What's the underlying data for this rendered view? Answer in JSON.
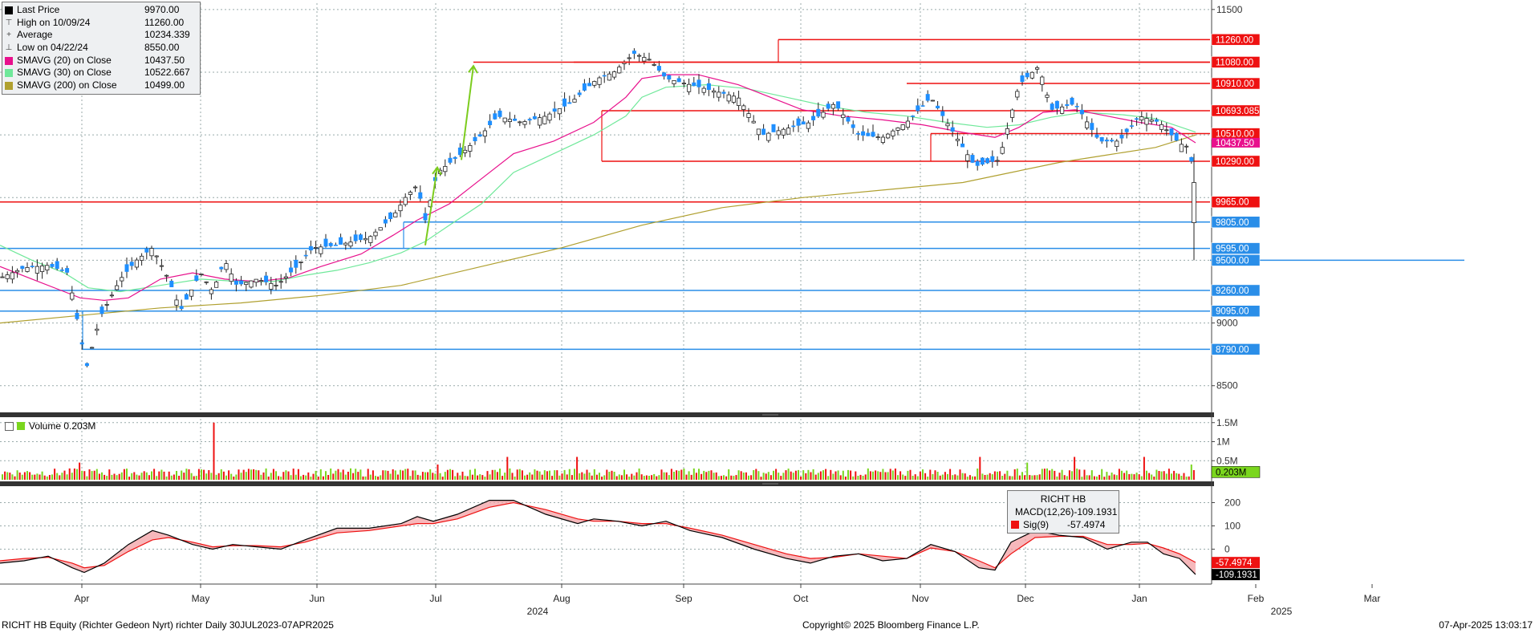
{
  "legend": {
    "last_price_label": "Last Price",
    "last_price": "9970.00",
    "high_label": "High on 10/09/24",
    "high": "11260.00",
    "average_label": "Average",
    "average": "10234.339",
    "low_label": "Low on 04/22/24",
    "low": "8550.00",
    "sma20_label": "SMAVG (20)  on Close",
    "sma20": "10437.50",
    "sma30_label": "SMAVG (30)  on Close",
    "sma30": "10522.667",
    "sma200_label": "SMAVG (200)  on Close",
    "sma200": "10499.00"
  },
  "volume_legend": {
    "label": "Volume",
    "value": "0.203M"
  },
  "macd_legend": {
    "title": "RICHT HB",
    "macd_label": "MACD(12,26)",
    "macd_value": "-109.1931",
    "sig_label": "Sig(9)",
    "sig_value": "-57.4974"
  },
  "footer": {
    "left": "RICHT HB Equity (Richter Gedeon Nyrt) richter  Daily 30JUL2023-07APR2025",
    "center": "Copyright© 2025 Bloomberg Finance L.P.",
    "right": "07-Apr-2025 13:03:17"
  },
  "colors": {
    "up": "#1f8fff",
    "down": "#1f8fff",
    "sma20": "#e8108c",
    "sma30": "#6fe89a",
    "sma200": "#b0a030",
    "vol_up": "#7ad61e",
    "vol_down": "#ee1111",
    "resistance": "#ee1111",
    "support": "#2a8ee8",
    "arrow": "#7ccc1e",
    "macd": "#000000",
    "signal": "#ee1111"
  },
  "chart_data": {
    "type": "candlestick",
    "price_axis": {
      "ticks": [
        8500,
        9000,
        11500
      ],
      "range": [
        8300,
        11550
      ]
    },
    "time_axis": {
      "months": [
        "Apr",
        "May",
        "Jun",
        "Jul",
        "Aug",
        "Sep",
        "Oct",
        "Nov",
        "Dec",
        "Jan",
        "Feb",
        "Mar"
      ],
      "years": [
        "2024",
        "2025"
      ]
    },
    "horizontal_levels": [
      {
        "value": 11260.0,
        "label": "11260.00",
        "kind": "resistance"
      },
      {
        "value": 11080.0,
        "label": "11080.00",
        "kind": "resistance"
      },
      {
        "value": 10910.0,
        "label": "10910.00",
        "kind": "resistance"
      },
      {
        "value": 10693.085,
        "label": "10693.085",
        "kind": "resistance"
      },
      {
        "value": 10510.0,
        "label": "10510.00",
        "kind": "resistance"
      },
      {
        "value": 10290.0,
        "label": "10290.00",
        "kind": "resistance"
      },
      {
        "value": 9965.0,
        "label": "9965.00",
        "kind": "resistance"
      },
      {
        "value": 9805.0,
        "label": "9805.00",
        "kind": "support"
      },
      {
        "value": 9595.0,
        "label": "9595.00",
        "kind": "support"
      },
      {
        "value": 9500.0,
        "label": "9500.00",
        "kind": "support"
      },
      {
        "value": 9260.0,
        "label": "9260.00",
        "kind": "support"
      },
      {
        "value": 9095.0,
        "label": "9095.00",
        "kind": "support"
      },
      {
        "value": 8790.0,
        "label": "8790.00",
        "kind": "support"
      }
    ],
    "axis_badges": [
      {
        "value": 10437.5,
        "label": "10437.50"
      },
      {
        "value": 10390,
        "label": "10290.00"
      }
    ],
    "close_path": [
      [
        0,
        9360
      ],
      [
        30,
        9440
      ],
      [
        60,
        9460
      ],
      [
        85,
        9400
      ],
      [
        100,
        8900
      ],
      [
        108,
        8650
      ],
      [
        125,
        9050
      ],
      [
        150,
        9350
      ],
      [
        170,
        9500
      ],
      [
        190,
        9600
      ],
      [
        210,
        9350
      ],
      [
        225,
        9100
      ],
      [
        250,
        9400
      ],
      [
        265,
        9250
      ],
      [
        280,
        9500
      ],
      [
        295,
        9300
      ],
      [
        320,
        9350
      ],
      [
        345,
        9300
      ],
      [
        370,
        9450
      ],
      [
        390,
        9600
      ],
      [
        420,
        9620
      ],
      [
        460,
        9680
      ],
      [
        490,
        9850
      ],
      [
        505,
        10000
      ],
      [
        520,
        10100
      ],
      [
        530,
        9820
      ],
      [
        545,
        10200
      ],
      [
        575,
        10350
      ],
      [
        600,
        10500
      ],
      [
        620,
        10650
      ],
      [
        650,
        10600
      ],
      [
        680,
        10650
      ],
      [
        710,
        10750
      ],
      [
        745,
        10950
      ],
      [
        765,
        11000
      ],
      [
        790,
        11150
      ],
      [
        810,
        11100
      ],
      [
        830,
        10950
      ],
      [
        860,
        10900
      ],
      [
        890,
        10850
      ],
      [
        920,
        10800
      ],
      [
        950,
        10500
      ],
      [
        980,
        10550
      ],
      [
        1010,
        10600
      ],
      [
        1040,
        10750
      ],
      [
        1070,
        10500
      ],
      [
        1100,
        10480
      ],
      [
        1130,
        10600
      ],
      [
        1160,
        10800
      ],
      [
        1190,
        10500
      ],
      [
        1215,
        10250
      ],
      [
        1245,
        10300
      ],
      [
        1270,
        10900
      ],
      [
        1295,
        11050
      ],
      [
        1310,
        10700
      ],
      [
        1340,
        10750
      ],
      [
        1370,
        10450
      ],
      [
        1395,
        10450
      ],
      [
        1420,
        10650
      ],
      [
        1445,
        10600
      ],
      [
        1470,
        10430
      ],
      [
        1483,
        10400
      ],
      [
        1490,
        9970
      ],
      [
        1495,
        9970
      ]
    ],
    "sma20": [
      [
        0,
        9450
      ],
      [
        40,
        9350
      ],
      [
        80,
        9250
      ],
      [
        100,
        9200
      ],
      [
        130,
        9180
      ],
      [
        160,
        9200
      ],
      [
        200,
        9350
      ],
      [
        240,
        9400
      ],
      [
        280,
        9350
      ],
      [
        320,
        9330
      ],
      [
        360,
        9360
      ],
      [
        400,
        9450
      ],
      [
        450,
        9550
      ],
      [
        490,
        9700
      ],
      [
        520,
        9820
      ],
      [
        560,
        9950
      ],
      [
        600,
        10150
      ],
      [
        640,
        10350
      ],
      [
        690,
        10450
      ],
      [
        740,
        10600
      ],
      [
        780,
        10800
      ],
      [
        800,
        10950
      ],
      [
        830,
        10980
      ],
      [
        870,
        10980
      ],
      [
        920,
        10900
      ],
      [
        960,
        10800
      ],
      [
        1000,
        10700
      ],
      [
        1050,
        10650
      ],
      [
        1100,
        10620
      ],
      [
        1150,
        10580
      ],
      [
        1200,
        10520
      ],
      [
        1240,
        10480
      ],
      [
        1270,
        10560
      ],
      [
        1300,
        10680
      ],
      [
        1340,
        10700
      ],
      [
        1380,
        10650
      ],
      [
        1420,
        10600
      ],
      [
        1460,
        10560
      ],
      [
        1490,
        10437
      ]
    ],
    "sma30": [
      [
        0,
        9620
      ],
      [
        40,
        9500
      ],
      [
        80,
        9400
      ],
      [
        110,
        9280
      ],
      [
        150,
        9250
      ],
      [
        200,
        9300
      ],
      [
        250,
        9350
      ],
      [
        300,
        9330
      ],
      [
        340,
        9330
      ],
      [
        380,
        9380
      ],
      [
        420,
        9420
      ],
      [
        460,
        9480
      ],
      [
        500,
        9560
      ],
      [
        530,
        9650
      ],
      [
        560,
        9780
      ],
      [
        600,
        9950
      ],
      [
        640,
        10200
      ],
      [
        690,
        10350
      ],
      [
        740,
        10500
      ],
      [
        780,
        10650
      ],
      [
        800,
        10800
      ],
      [
        830,
        10880
      ],
      [
        880,
        10900
      ],
      [
        930,
        10870
      ],
      [
        980,
        10800
      ],
      [
        1030,
        10730
      ],
      [
        1080,
        10680
      ],
      [
        1130,
        10650
      ],
      [
        1180,
        10600
      ],
      [
        1230,
        10560
      ],
      [
        1270,
        10580
      ],
      [
        1310,
        10640
      ],
      [
        1350,
        10680
      ],
      [
        1400,
        10660
      ],
      [
        1440,
        10630
      ],
      [
        1490,
        10522
      ]
    ],
    "sma200": [
      [
        0,
        9000
      ],
      [
        100,
        9060
      ],
      [
        200,
        9120
      ],
      [
        300,
        9160
      ],
      [
        400,
        9220
      ],
      [
        500,
        9300
      ],
      [
        600,
        9450
      ],
      [
        700,
        9600
      ],
      [
        800,
        9780
      ],
      [
        900,
        9920
      ],
      [
        1000,
        10000
      ],
      [
        1100,
        10060
      ],
      [
        1200,
        10120
      ],
      [
        1260,
        10200
      ],
      [
        1320,
        10280
      ],
      [
        1380,
        10340
      ],
      [
        1440,
        10400
      ],
      [
        1490,
        10499
      ]
    ],
    "volume": {
      "axis_ticks": [
        "1.5M",
        "1M",
        "0.5M"
      ],
      "last": "0.203M",
      "spikes": [
        [
          266,
          1.5
        ],
        [
          632,
          0.6
        ],
        [
          720,
          0.6
        ],
        [
          1220,
          0.6
        ],
        [
          1340,
          0.6
        ],
        [
          1427,
          0.6
        ],
        [
          1485,
          0.4
        ],
        [
          100,
          0.45
        ],
        [
          545,
          0.4
        ],
        [
          1280,
          0.45
        ]
      ]
    },
    "macd": {
      "axis_ticks": [
        200,
        100,
        0
      ],
      "range": [
        -150,
        250
      ],
      "macd_last": -109.1931,
      "signal_last": -57.4974,
      "macd": [
        [
          0,
          -60
        ],
        [
          30,
          -50
        ],
        [
          60,
          -30
        ],
        [
          90,
          -80
        ],
        [
          105,
          -100
        ],
        [
          130,
          -60
        ],
        [
          160,
          20
        ],
        [
          190,
          80
        ],
        [
          210,
          60
        ],
        [
          240,
          20
        ],
        [
          265,
          0
        ],
        [
          290,
          20
        ],
        [
          320,
          10
        ],
        [
          350,
          0
        ],
        [
          380,
          40
        ],
        [
          420,
          90
        ],
        [
          460,
          90
        ],
        [
          500,
          110
        ],
        [
          520,
          140
        ],
        [
          540,
          120
        ],
        [
          570,
          150
        ],
        [
          610,
          210
        ],
        [
          640,
          210
        ],
        [
          680,
          150
        ],
        [
          720,
          110
        ],
        [
          740,
          130
        ],
        [
          770,
          120
        ],
        [
          800,
          100
        ],
        [
          830,
          120
        ],
        [
          860,
          80
        ],
        [
          900,
          50
        ],
        [
          940,
          0
        ],
        [
          980,
          -40
        ],
        [
          1010,
          -60
        ],
        [
          1040,
          -30
        ],
        [
          1070,
          -20
        ],
        [
          1100,
          -50
        ],
        [
          1130,
          -40
        ],
        [
          1160,
          20
        ],
        [
          1190,
          -10
        ],
        [
          1220,
          -80
        ],
        [
          1240,
          -90
        ],
        [
          1260,
          30
        ],
        [
          1290,
          80
        ],
        [
          1320,
          60
        ],
        [
          1350,
          50
        ],
        [
          1380,
          0
        ],
        [
          1410,
          30
        ],
        [
          1430,
          30
        ],
        [
          1450,
          -20
        ],
        [
          1470,
          -40
        ],
        [
          1490,
          -109
        ]
      ],
      "signal": [
        [
          0,
          -50
        ],
        [
          30,
          -40
        ],
        [
          60,
          -35
        ],
        [
          90,
          -60
        ],
        [
          105,
          -80
        ],
        [
          130,
          -70
        ],
        [
          160,
          -10
        ],
        [
          190,
          40
        ],
        [
          210,
          50
        ],
        [
          240,
          30
        ],
        [
          265,
          10
        ],
        [
          290,
          15
        ],
        [
          320,
          15
        ],
        [
          350,
          10
        ],
        [
          380,
          30
        ],
        [
          420,
          70
        ],
        [
          460,
          80
        ],
        [
          500,
          100
        ],
        [
          520,
          110
        ],
        [
          540,
          110
        ],
        [
          570,
          130
        ],
        [
          610,
          180
        ],
        [
          640,
          200
        ],
        [
          680,
          170
        ],
        [
          720,
          130
        ],
        [
          740,
          120
        ],
        [
          770,
          120
        ],
        [
          800,
          110
        ],
        [
          830,
          110
        ],
        [
          860,
          90
        ],
        [
          900,
          60
        ],
        [
          940,
          20
        ],
        [
          980,
          -20
        ],
        [
          1010,
          -40
        ],
        [
          1040,
          -35
        ],
        [
          1070,
          -20
        ],
        [
          1100,
          -30
        ],
        [
          1130,
          -40
        ],
        [
          1160,
          5
        ],
        [
          1190,
          -10
        ],
        [
          1220,
          -50
        ],
        [
          1240,
          -80
        ],
        [
          1260,
          -20
        ],
        [
          1290,
          50
        ],
        [
          1320,
          55
        ],
        [
          1350,
          55
        ],
        [
          1380,
          20
        ],
        [
          1410,
          20
        ],
        [
          1430,
          25
        ],
        [
          1450,
          5
        ],
        [
          1470,
          -20
        ],
        [
          1490,
          -57
        ]
      ]
    }
  }
}
